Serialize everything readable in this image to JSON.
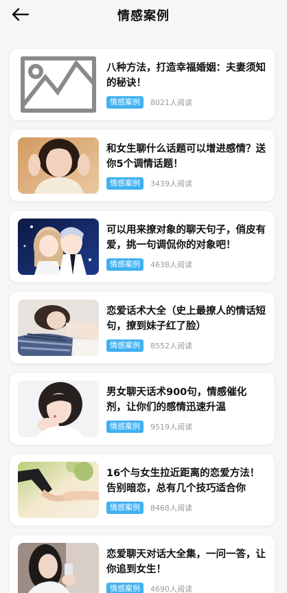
{
  "header": {
    "title": "情感案例",
    "back_icon": "arrow-left-icon"
  },
  "colors": {
    "tag_bg": "#3fb0f0",
    "page_bg": "#f6f6f6",
    "card_bg": "#ffffff"
  },
  "articles": [
    {
      "title": "八种方法，打造幸福婚姻：夫妻须知的秘诀！",
      "tag": "情感案例",
      "reads": "8021人阅读",
      "image": "placeholder-image-icon"
    },
    {
      "title": "和女生聊什么话题可以增进感情？送你5个调情话题！",
      "tag": "情感案例",
      "reads": "3439人阅读",
      "image": "girl-portrait-photo"
    },
    {
      "title": "可以用来撩对象的聊天句子，俏皮有爱，挑一句调侃你的对象吧！",
      "tag": "情感案例",
      "reads": "4638人阅读",
      "image": "anime-couple-illustration"
    },
    {
      "title": "恋爱话术大全（史上最撩人的情话短句，撩到妹子红了脸）",
      "tag": "情感案例",
      "reads": "8552人阅读",
      "image": "girl-on-pillow-photo"
    },
    {
      "title": "男女聊天话术900句，情感催化剂，让你们的感情迅速升温",
      "tag": "情感案例",
      "reads": "9519人阅读",
      "image": "girl-short-hair-photo"
    },
    {
      "title": "16个与女生拉近距离的恋爱方法！告别暗恋，总有几个技巧适合你",
      "tag": "情感案例",
      "reads": "8468人阅读",
      "image": "holding-hands-photo"
    },
    {
      "title": "恋爱聊天对话大全集，一问一答，让你追到女生！",
      "tag": "情感案例",
      "reads": "4690人阅读",
      "image": "girl-with-phone-photo"
    }
  ]
}
